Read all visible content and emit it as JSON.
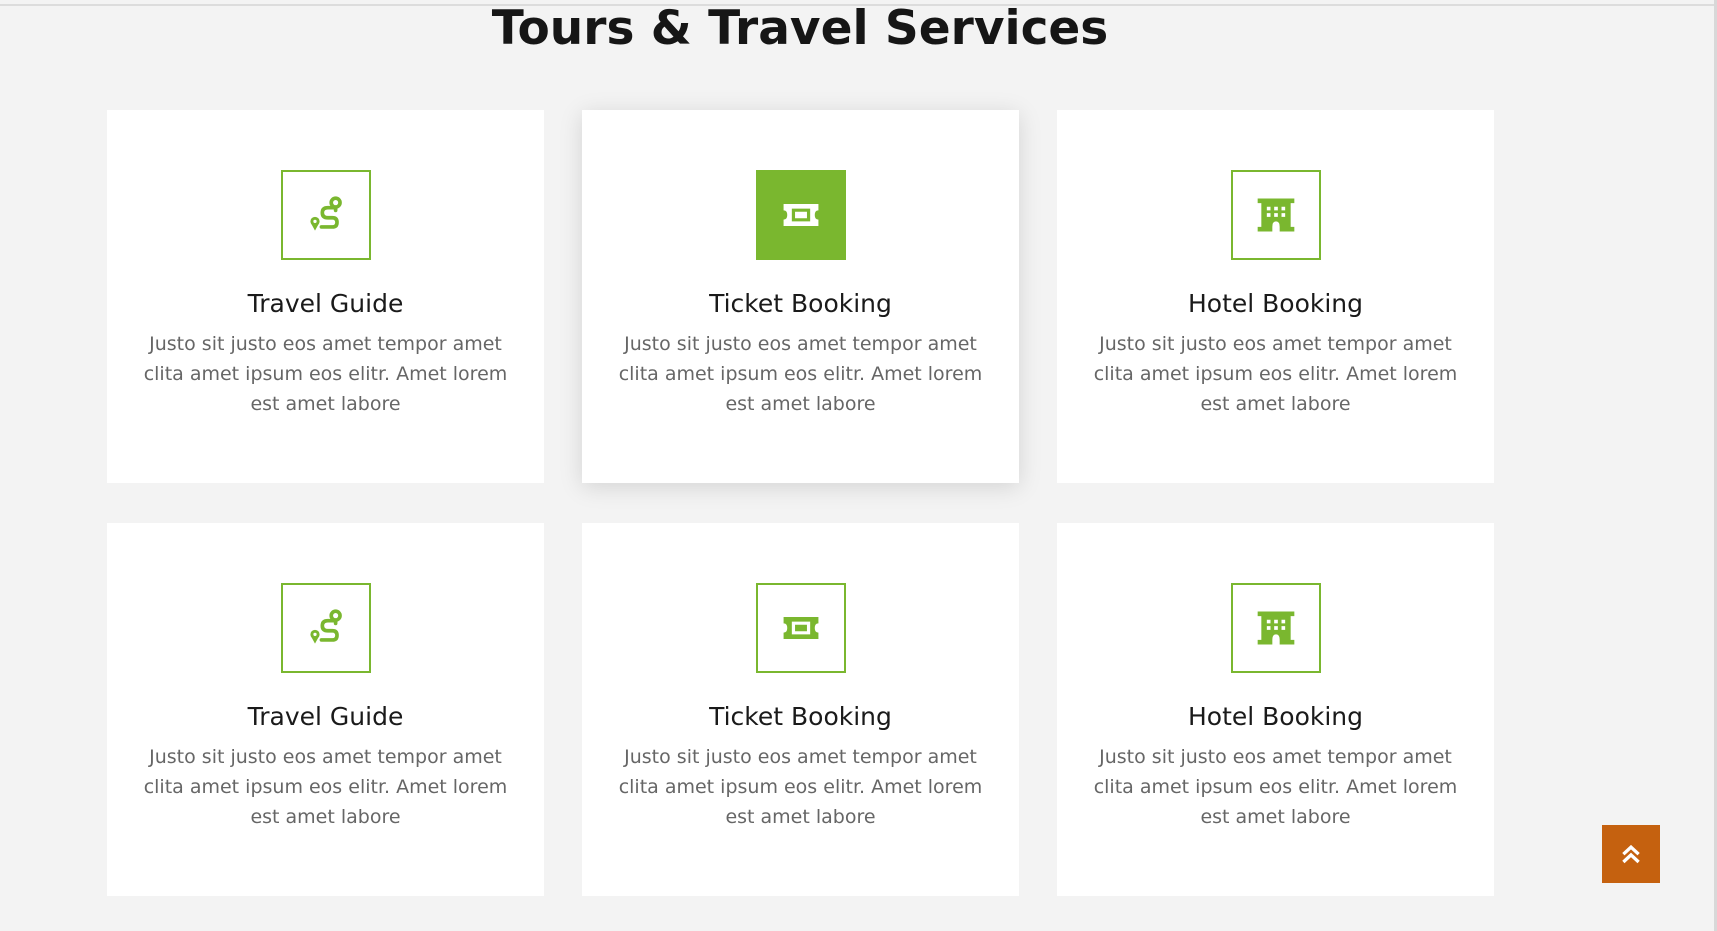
{
  "section": {
    "title": "Tours & Travel Services"
  },
  "services": [
    {
      "title": "Travel Guide",
      "text": "Justo sit justo eos amet tempor amet clita amet ipsum eos elitr. Amet lorem est amet labore",
      "icon": "route-icon"
    },
    {
      "title": "Ticket Booking",
      "text": "Justo sit justo eos amet tempor amet clita amet ipsum eos elitr. Amet lorem est amet labore",
      "icon": "ticket-icon"
    },
    {
      "title": "Hotel Booking",
      "text": "Justo sit justo eos amet tempor amet clita amet ipsum eos elitr. Amet lorem est amet labore",
      "icon": "hotel-icon"
    },
    {
      "title": "Travel Guide",
      "text": "Justo sit justo eos amet tempor amet clita amet ipsum eos elitr. Amet lorem est amet labore",
      "icon": "route-icon"
    },
    {
      "title": "Ticket Booking",
      "text": "Justo sit justo eos amet tempor amet clita amet ipsum eos elitr. Amet lorem est amet labore",
      "icon": "ticket-icon"
    },
    {
      "title": "Hotel Booking",
      "text": "Justo sit justo eos amet tempor amet clita amet ipsum eos elitr. Amet lorem est amet labore",
      "icon": "hotel-icon"
    }
  ],
  "back_to_top": {
    "icon": "double-chevron-up-icon"
  },
  "colors": {
    "accent": "#7ab72f",
    "back_to_top": "#c5610f",
    "background": "#f3f3f3",
    "card": "#ffffff",
    "title": "#161616",
    "body_text": "#666666"
  }
}
